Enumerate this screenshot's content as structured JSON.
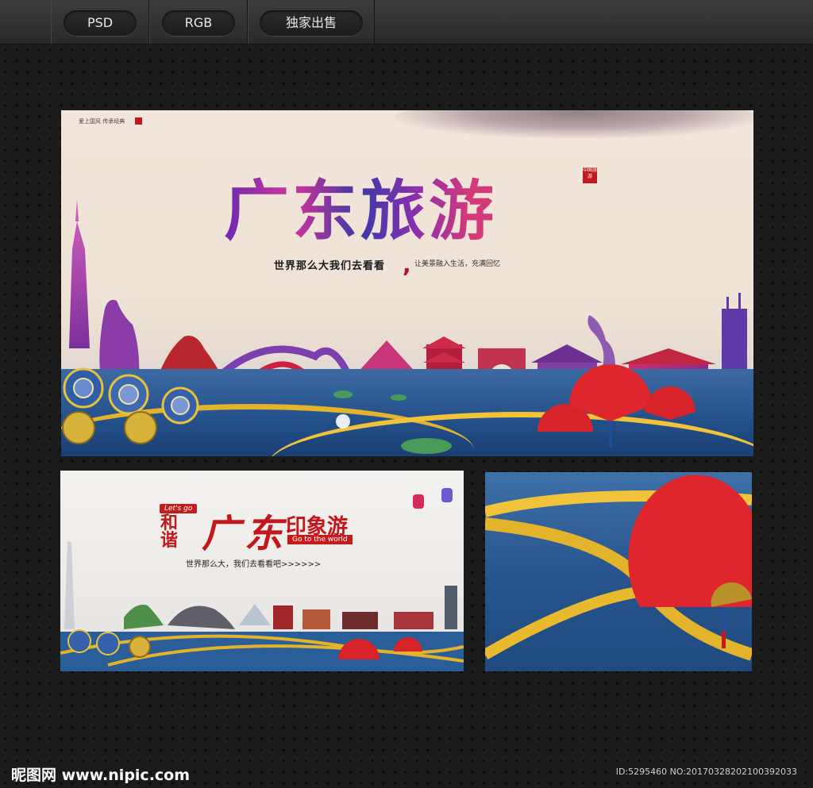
{
  "toolbar": {
    "tabs": [
      {
        "label": "PSD"
      },
      {
        "label": "RGB"
      },
      {
        "label": "独家出售"
      }
    ]
  },
  "main_poster": {
    "title": "广东旅游",
    "subtitle": "世界那么大我们去看看",
    "slogan": "让美景融入生活，充满回忆",
    "corner_text": "爱上国风 传承经典",
    "seal_text": "中国旅游"
  },
  "left_poster": {
    "badge_lets_go": "Let's go",
    "hexie": "和谐",
    "title_main": "广东",
    "title_side": "印象游",
    "badge_go_world": "Go to the world",
    "subtitle": "世界那么大，我们去看看吧>>>>>>"
  },
  "footer": {
    "logo": "昵图网 www.nipic.com",
    "id_text": "ID:5295460 NO:20170328202100392033"
  },
  "colors": {
    "accent_red": "#c2181b",
    "water_blue": "#23508a",
    "gold": "#e3b32b",
    "purple": "#6b2bb0"
  }
}
